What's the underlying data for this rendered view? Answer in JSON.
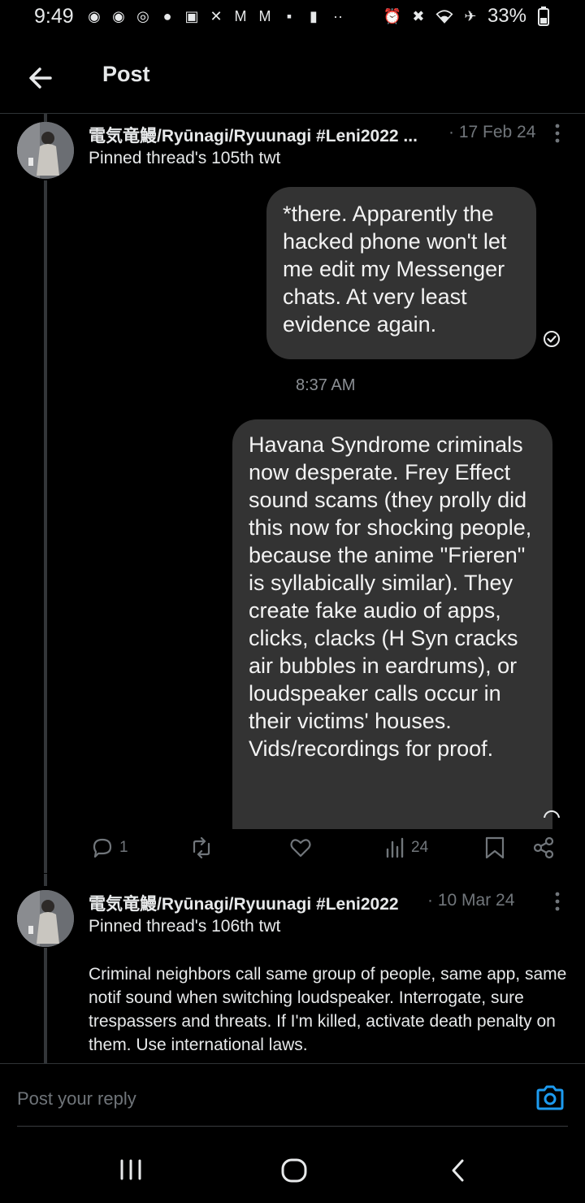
{
  "status_bar": {
    "time": "9:49",
    "battery": "33%"
  },
  "header": {
    "title": "Post"
  },
  "posts": [
    {
      "author": "電気竜鰻/Ryūnagi/Ryuunagi #Leni2022 ...",
      "dot_date": "· 17 Feb 24",
      "subtitle": "Pinned thread's 105th twt",
      "bubble1": "*there. Apparently the hacked phone won't let me edit my Messenger chats. At very least evidence again.",
      "time": "8:37 AM",
      "bubble2": "Havana Syndrome criminals now desperate. Frey Effect sound scams (they prolly did this now for shocking people, because the anime \"Frieren\" is syllabically similar). They create fake audio of apps, clicks, clacks (H Syn cracks air bubbles in eardrums), or loudspeaker calls occur in their victims' houses. Vids/recordings for proof.",
      "replies": "1",
      "views": "24"
    },
    {
      "author": "電気竜鰻/Ryūnagi/Ryuunagi #Leni2022",
      "dot_date": "· 10 Mar 24",
      "subtitle": "Pinned thread's 106th twt",
      "body": "Criminal neighbors call same group of people, same app, same notif sound when switching loudspeaker. Interrogate, sure trespassers and threats. If I'm killed, activate death penalty on them. Use international laws."
    }
  ],
  "reply": {
    "placeholder": "Post your reply"
  },
  "colors": {
    "accent": "#1d9bf0",
    "bubble": "#333333",
    "muted": "#71767b"
  }
}
